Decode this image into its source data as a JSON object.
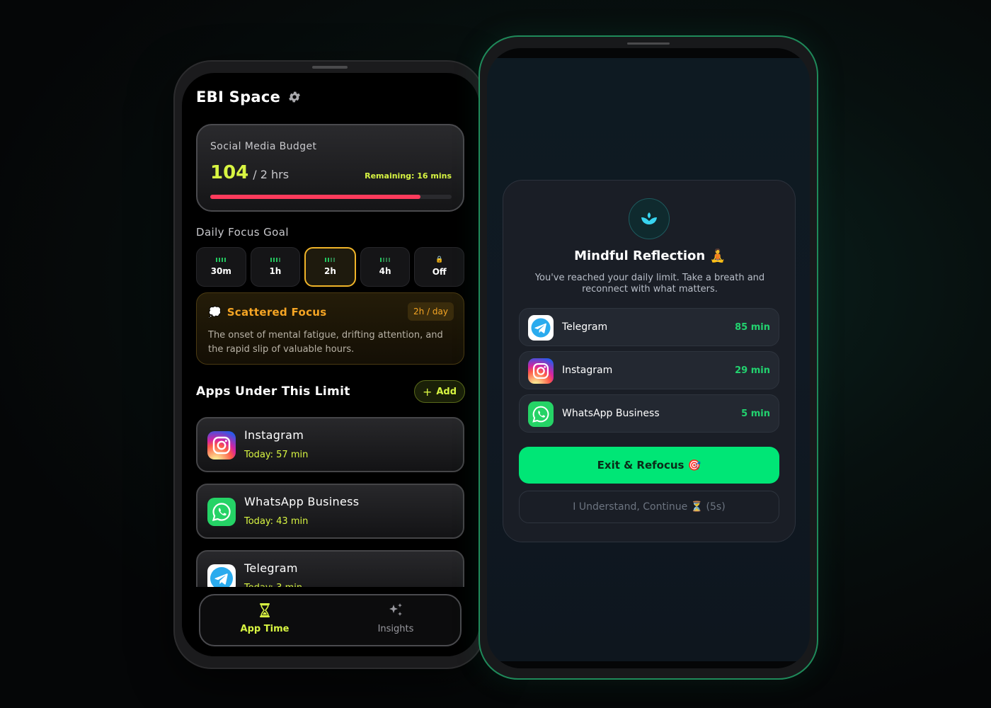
{
  "left_phone": {
    "app_title": "EBI Space",
    "budget": {
      "label": "Social Media Budget",
      "used": "104",
      "total": "/ 2 hrs",
      "remaining": "Remaining: 16 mins",
      "progress_fraction": 0.87,
      "bar_color": "#ff3b5c"
    },
    "focus_goal": {
      "label": "Daily Focus Goal",
      "options": [
        {
          "label": "30m",
          "bars_on": 4,
          "active": false
        },
        {
          "label": "1h",
          "bars_on": 3,
          "active": false
        },
        {
          "label": "2h",
          "bars_on": 2,
          "active": true
        },
        {
          "label": "4h",
          "bars_on": 1,
          "active": false
        },
        {
          "label": "Off",
          "bars_on": 0,
          "active": false,
          "icon": "lock-icon"
        }
      ]
    },
    "warning": {
      "icon": "thought-bubble-icon",
      "title": "Scattered Focus",
      "tag": "2h / day",
      "description": "The onset of mental fatigue, drifting attention, and the rapid slip of valuable hours."
    },
    "apps_section": {
      "title": "Apps Under This Limit",
      "add_label": "Add"
    },
    "apps": [
      {
        "name": "Instagram",
        "today": "Today: 57 min",
        "icon": "instagram-icon"
      },
      {
        "name": "WhatsApp Business",
        "today": "Today: 43 min",
        "icon": "whatsapp-business-icon"
      },
      {
        "name": "Telegram",
        "today": "Today: 3 min",
        "icon": "telegram-icon"
      }
    ],
    "nav": {
      "app_time": "App Time",
      "insights": "Insights"
    },
    "accent_color": "#d8f542",
    "warning_color": "#f5a524"
  },
  "right_phone": {
    "modal": {
      "icon": "lotus-icon",
      "title": "Mindful Reflection 🧘",
      "description": "You've reached your daily limit. Take a breath and reconnect with what matters.",
      "apps": [
        {
          "name": "Telegram",
          "minutes": "85 min",
          "icon": "telegram-icon"
        },
        {
          "name": "Instagram",
          "minutes": "29 min",
          "icon": "instagram-icon"
        },
        {
          "name": "WhatsApp Business",
          "minutes": "5 min",
          "icon": "whatsapp-business-icon"
        }
      ],
      "exit_label": "Exit & Refocus 🎯",
      "continue_label": "I Understand, Continue ⏳ (5s)"
    },
    "accent_color": "#00e676",
    "border_color": "#1f8a5a"
  }
}
